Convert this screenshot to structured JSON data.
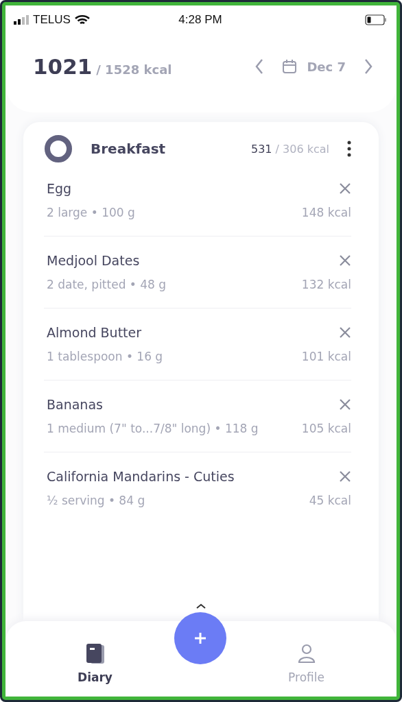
{
  "status_bar": {
    "carrier": "TELUS",
    "time": "4:28 PM"
  },
  "summary": {
    "consumed": "1021",
    "goal": "/ 1528 kcal",
    "date": "Dec 7"
  },
  "meal": {
    "name": "Breakfast",
    "consumed": "531",
    "goal": "/ 306 kcal",
    "items": [
      {
        "name": "Egg",
        "serving": "2 large • 100 g",
        "calories": "148 kcal"
      },
      {
        "name": "Medjool Dates",
        "serving": "2 date, pitted • 48 g",
        "calories": "132 kcal"
      },
      {
        "name": "Almond Butter",
        "serving": "1 tablespoon • 16 g",
        "calories": "101 kcal"
      },
      {
        "name": "Bananas",
        "serving": "1 medium (7\" to...7/8\" long) • 118 g",
        "calories": "105 kcal"
      },
      {
        "name": "California Mandarins - Cuties",
        "serving": "½ serving • 84 g",
        "calories": "45 kcal"
      }
    ]
  },
  "tabs": [
    {
      "label": "Diary",
      "kind": "diary",
      "selected": true
    },
    {
      "label": "Profile",
      "kind": "profile",
      "selected": false
    }
  ]
}
